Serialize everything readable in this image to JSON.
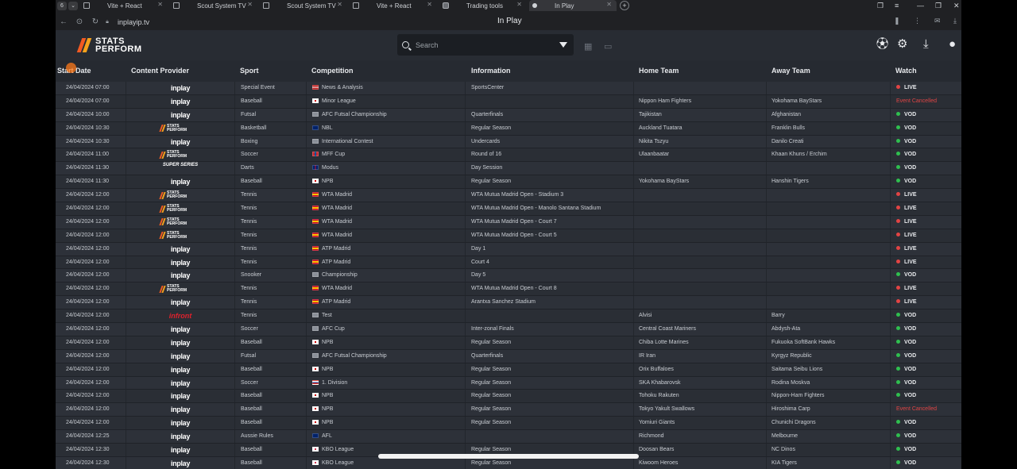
{
  "browser": {
    "tabs": [
      {
        "label": "Vite + React",
        "favicon": "page-icon"
      },
      {
        "label": "Scout System TV",
        "favicon": "page-icon"
      },
      {
        "label": "Scout System TV",
        "favicon": "page-icon"
      },
      {
        "label": "Vite + React",
        "favicon": "page-icon"
      },
      {
        "label": "Trading tools",
        "favicon": "tv-icon"
      },
      {
        "label": "In Play",
        "favicon": "active-dot-icon",
        "active": true
      }
    ],
    "profile_count": "6",
    "url": "inplayip.tv",
    "page_title": "In Play"
  },
  "header": {
    "logo_line1": "STATS",
    "logo_line2": "PERFORM",
    "search_placeholder": "Search"
  },
  "table": {
    "columns": [
      "Start Date",
      "Content Provider",
      "Sport",
      "Competition",
      "Information",
      "Home Team",
      "Away Team",
      "Watch"
    ],
    "rows": [
      {
        "date": "24/04/2024 07:00",
        "provider": "inplay",
        "provider_label": "inplay",
        "sport": "Special Event",
        "flag": "us",
        "competition": "News & Analysis",
        "info": "SportsCenter",
        "home": "",
        "away": "",
        "watch": "LIVE"
      },
      {
        "date": "24/04/2024 07:00",
        "provider": "inplay",
        "provider_label": "inplay",
        "sport": "Baseball",
        "flag": "jp",
        "competition": "Minor League",
        "info": "",
        "home": "Nippon Ham Fighters",
        "away": "Yokohama BayStars",
        "watch": "Event Cancelled"
      },
      {
        "date": "24/04/2024 10:00",
        "provider": "inplay",
        "provider_label": "inplay",
        "sport": "Futsal",
        "flag": "intl",
        "competition": "AFC Futsal Championship",
        "info": "Quarterfinals",
        "home": "Tajikistan",
        "away": "Afghanistan",
        "watch": "VOD"
      },
      {
        "date": "24/04/2024 10:30",
        "provider": "stats",
        "provider_label": "STATS PERFORM",
        "sport": "Basketball",
        "flag": "nz",
        "competition": "NBL",
        "info": "Regular Season",
        "home": "Auckland Tuatara",
        "away": "Franklin Bulls",
        "watch": "VOD"
      },
      {
        "date": "24/04/2024 10:30",
        "provider": "inplay",
        "provider_label": "inplay",
        "sport": "Boxing",
        "flag": "intl",
        "competition": "International Contest",
        "info": "Undercards",
        "home": "Nikita Tszyu",
        "away": "Danilo Creati",
        "watch": "VOD"
      },
      {
        "date": "24/04/2024 11:00",
        "provider": "stats",
        "provider_label": "STATS PERFORM",
        "sport": "Soccer",
        "flag": "mn",
        "competition": "MFF Cup",
        "info": "Round of 16",
        "home": "Ulaanbaatar",
        "away": "Khaan Khuns / Erchim",
        "watch": "VOD"
      },
      {
        "date": "24/04/2024 11:30",
        "provider": "super",
        "provider_label": "SUPER SERIES",
        "sport": "Darts",
        "flag": "gb",
        "competition": "Modus",
        "info": "Day Session",
        "home": "",
        "away": "",
        "watch": "VOD"
      },
      {
        "date": "24/04/2024 11:30",
        "provider": "inplay",
        "provider_label": "inplay",
        "sport": "Baseball",
        "flag": "jp",
        "competition": "NPB",
        "info": "Regular Season",
        "home": "Yokohama BayStars",
        "away": "Hanshin Tigers",
        "watch": "VOD"
      },
      {
        "date": "24/04/2024 12:00",
        "provider": "stats",
        "provider_label": "STATS PERFORM",
        "sport": "Tennis",
        "flag": "es",
        "competition": "WTA Madrid",
        "info": "WTA Mutua Madrid Open - Stadium 3",
        "home": "",
        "away": "",
        "watch": "LIVE"
      },
      {
        "date": "24/04/2024 12:00",
        "provider": "stats",
        "provider_label": "STATS PERFORM",
        "sport": "Tennis",
        "flag": "es",
        "competition": "WTA Madrid",
        "info": "WTA Mutua Madrid Open - Manolo Santana Stadium",
        "home": "",
        "away": "",
        "watch": "LIVE"
      },
      {
        "date": "24/04/2024 12:00",
        "provider": "stats",
        "provider_label": "STATS PERFORM",
        "sport": "Tennis",
        "flag": "es",
        "competition": "WTA Madrid",
        "info": "WTA Mutua Madrid Open - Court 7",
        "home": "",
        "away": "",
        "watch": "LIVE"
      },
      {
        "date": "24/04/2024 12:00",
        "provider": "stats",
        "provider_label": "STATS PERFORM",
        "sport": "Tennis",
        "flag": "es",
        "competition": "WTA Madrid",
        "info": "WTA Mutua Madrid Open - Court 5",
        "home": "",
        "away": "",
        "watch": "LIVE"
      },
      {
        "date": "24/04/2024 12:00",
        "provider": "inplay",
        "provider_label": "inplay",
        "sport": "Tennis",
        "flag": "es",
        "competition": "ATP Madrid",
        "info": "Day 1",
        "home": "",
        "away": "",
        "watch": "LIVE"
      },
      {
        "date": "24/04/2024 12:00",
        "provider": "inplay",
        "provider_label": "inplay",
        "sport": "Tennis",
        "flag": "es",
        "competition": "ATP Madrid",
        "info": "Court 4",
        "home": "",
        "away": "",
        "watch": "LIVE"
      },
      {
        "date": "24/04/2024 12:00",
        "provider": "inplay",
        "provider_label": "inplay",
        "sport": "Snooker",
        "flag": "intl",
        "competition": "Championship",
        "info": "Day 5",
        "home": "",
        "away": "",
        "watch": "VOD"
      },
      {
        "date": "24/04/2024 12:00",
        "provider": "stats",
        "provider_label": "STATS PERFORM",
        "sport": "Tennis",
        "flag": "es",
        "competition": "WTA Madrid",
        "info": "WTA Mutua Madrid Open - Court 8",
        "home": "",
        "away": "",
        "watch": "LIVE"
      },
      {
        "date": "24/04/2024 12:00",
        "provider": "inplay",
        "provider_label": "inplay",
        "sport": "Tennis",
        "flag": "es",
        "competition": "ATP Madrid",
        "info": "Arantxa Sanchez Stadium",
        "home": "",
        "away": "",
        "watch": "LIVE"
      },
      {
        "date": "24/04/2024 12:00",
        "provider": "infront",
        "provider_label": "infront",
        "sport": "Tennis",
        "flag": "intl",
        "competition": "Test",
        "info": "",
        "home": "Alvisi",
        "away": "Barry",
        "watch": "VOD"
      },
      {
        "date": "24/04/2024 12:00",
        "provider": "inplay",
        "provider_label": "inplay",
        "sport": "Soccer",
        "flag": "intl",
        "competition": "AFC Cup",
        "info": "Inter-zonal Finals",
        "home": "Central Coast Mariners",
        "away": "Abdysh-Ata",
        "watch": "VOD"
      },
      {
        "date": "24/04/2024 12:00",
        "provider": "inplay",
        "provider_label": "inplay",
        "sport": "Baseball",
        "flag": "jp",
        "competition": "NPB",
        "info": "Regular Season",
        "home": "Chiba Lotte Marines",
        "away": "Fukuoka SoftBank Hawks",
        "watch": "VOD"
      },
      {
        "date": "24/04/2024 12:00",
        "provider": "inplay",
        "provider_label": "inplay",
        "sport": "Futsal",
        "flag": "intl",
        "competition": "AFC Futsal Championship",
        "info": "Quarterfinals",
        "home": "IR Iran",
        "away": "Kyrgyz Republic",
        "watch": "VOD"
      },
      {
        "date": "24/04/2024 12:00",
        "provider": "inplay",
        "provider_label": "inplay",
        "sport": "Baseball",
        "flag": "jp",
        "competition": "NPB",
        "info": "Regular Season",
        "home": "Orix Buffaloes",
        "away": "Saitama Seibu Lions",
        "watch": "VOD"
      },
      {
        "date": "24/04/2024 12:00",
        "provider": "inplay",
        "provider_label": "inplay",
        "sport": "Soccer",
        "flag": "ru",
        "competition": "1. Division",
        "info": "Regular Season",
        "home": "SKA Khabarovsk",
        "away": "Rodina Moskva",
        "watch": "VOD"
      },
      {
        "date": "24/04/2024 12:00",
        "provider": "inplay",
        "provider_label": "inplay",
        "sport": "Baseball",
        "flag": "jp",
        "competition": "NPB",
        "info": "Regular Season",
        "home": "Tohoku Rakuten",
        "away": "Nippon-Ham Fighters",
        "watch": "VOD"
      },
      {
        "date": "24/04/2024 12:00",
        "provider": "inplay",
        "provider_label": "inplay",
        "sport": "Baseball",
        "flag": "jp",
        "competition": "NPB",
        "info": "Regular Season",
        "home": "Tokyo Yakult Swallows",
        "away": "Hiroshima Carp",
        "watch": "Event Cancelled"
      },
      {
        "date": "24/04/2024 12:00",
        "provider": "inplay",
        "provider_label": "inplay",
        "sport": "Baseball",
        "flag": "jp",
        "competition": "NPB",
        "info": "Regular Season",
        "home": "Yomiuri Giants",
        "away": "Chunichi Dragons",
        "watch": "VOD"
      },
      {
        "date": "24/04/2024 12:25",
        "provider": "inplay",
        "provider_label": "inplay",
        "sport": "Aussie Rules",
        "flag": "au",
        "competition": "AFL",
        "info": "",
        "home": "Richmond",
        "away": "Melbourne",
        "watch": "VOD"
      },
      {
        "date": "24/04/2024 12:30",
        "provider": "inplay",
        "provider_label": "inplay",
        "sport": "Baseball",
        "flag": "kr",
        "competition": "KBO League",
        "info": "Regular Season",
        "home": "Doosan Bears",
        "away": "NC Dinos",
        "watch": "VOD"
      },
      {
        "date": "24/04/2024 12:30",
        "provider": "inplay",
        "provider_label": "inplay",
        "sport": "Baseball",
        "flag": "kr",
        "competition": "KBO League",
        "info": "Regular Season",
        "home": "Kiwoom Heroes",
        "away": "KIA Tigers",
        "watch": "VOD"
      }
    ]
  },
  "colors": {
    "live": "#e24444",
    "vod": "#2fbf4f",
    "cancelled": "#e04545",
    "brand_orange": "#f25a22",
    "brand_yellow": "#f7a21b",
    "app_bg": "#262a31"
  },
  "icons": [
    "search-icon",
    "filter-icon",
    "calendar-icon",
    "ticket-icon",
    "soccer-ball-icon",
    "settings-icon",
    "download-icon",
    "user-icon"
  ]
}
